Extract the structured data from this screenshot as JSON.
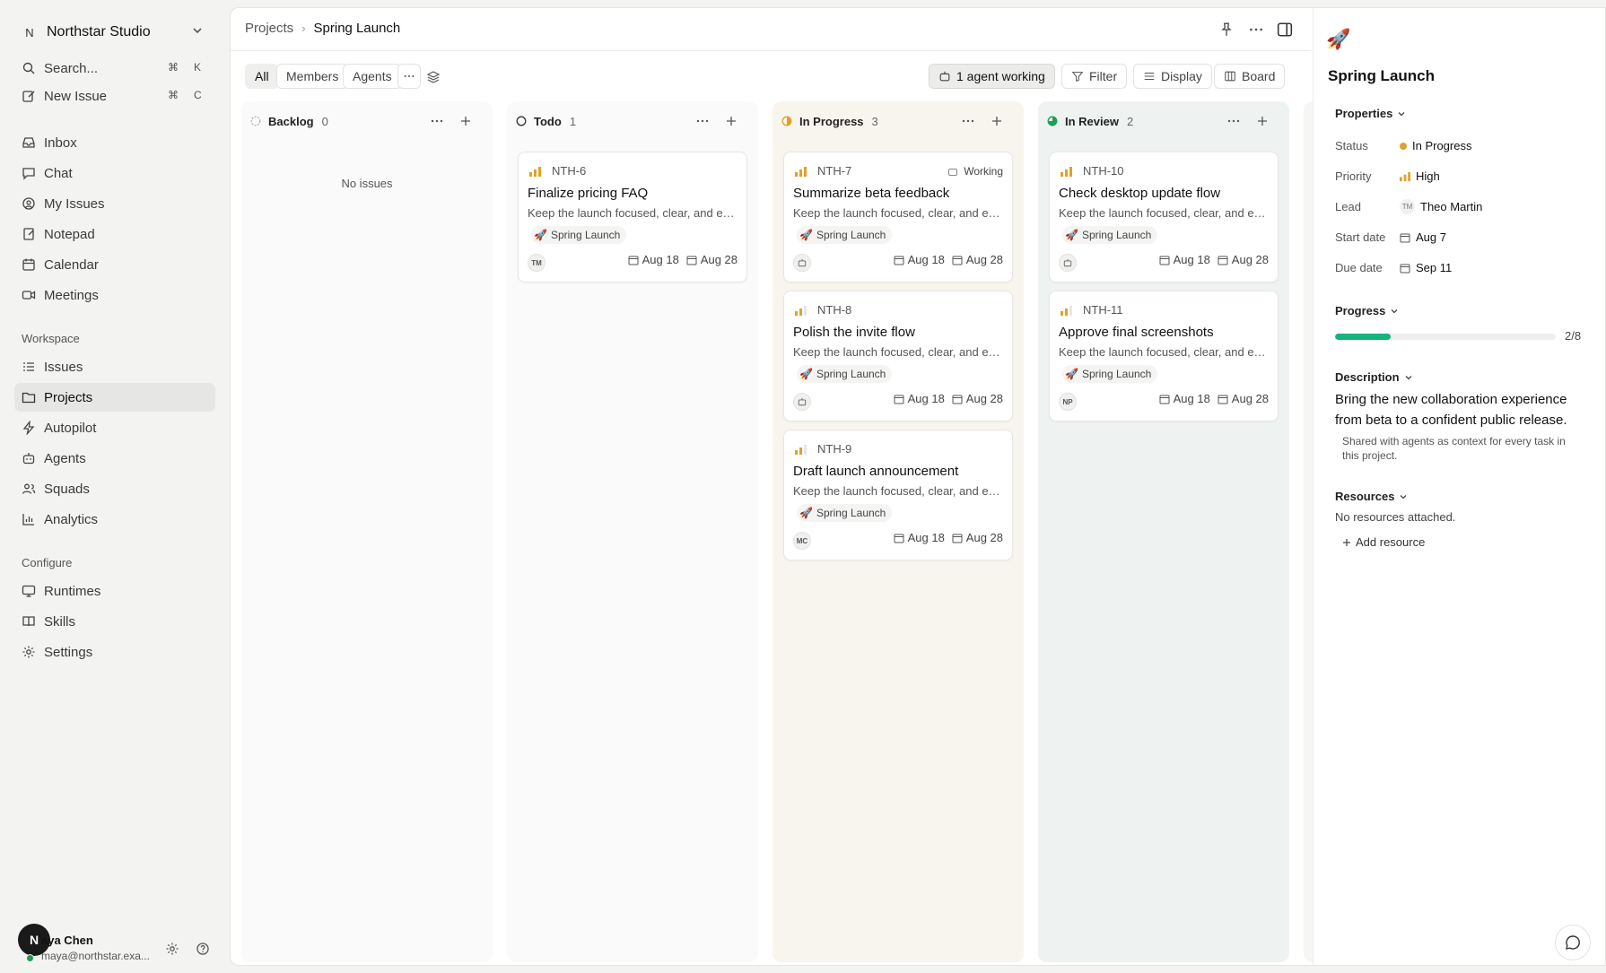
{
  "workspace": {
    "logo": "N",
    "name": "Northstar Studio"
  },
  "sidebar": {
    "search": {
      "label": "Search...",
      "kbd_mod": "⌘",
      "kbd_key": "K"
    },
    "new_issue": {
      "label": "New Issue",
      "kbd_mod": "⌘",
      "kbd_key": "C"
    },
    "primary": [
      {
        "label": "Inbox",
        "icon": "inbox-icon"
      },
      {
        "label": "Chat",
        "icon": "chat-icon"
      },
      {
        "label": "My Issues",
        "icon": "user-circle-icon"
      },
      {
        "label": "Notepad",
        "icon": "notepad-icon"
      },
      {
        "label": "Calendar",
        "icon": "calendar-icon"
      },
      {
        "label": "Meetings",
        "icon": "video-icon"
      }
    ],
    "workspace_heading": "Workspace",
    "workspace_items": [
      {
        "label": "Issues",
        "icon": "list-icon"
      },
      {
        "label": "Projects",
        "icon": "folder-icon"
      },
      {
        "label": "Autopilot",
        "icon": "bolt-icon"
      },
      {
        "label": "Agents",
        "icon": "bot-icon"
      },
      {
        "label": "Squads",
        "icon": "users-icon"
      },
      {
        "label": "Analytics",
        "icon": "chart-icon"
      }
    ],
    "configure_heading": "Configure",
    "configure_items": [
      {
        "label": "Runtimes",
        "icon": "monitor-icon"
      },
      {
        "label": "Skills",
        "icon": "book-icon"
      },
      {
        "label": "Settings",
        "icon": "gear-icon"
      }
    ],
    "active_item": "Projects"
  },
  "user": {
    "avatar": "N",
    "name": "aya Chen",
    "email": "maya@northstar.exa..."
  },
  "breadcrumb": {
    "parent": "Projects",
    "current": "Spring Launch"
  },
  "filters": {
    "tabs": [
      "All",
      "Members",
      "Agents"
    ],
    "selected_tab": "All",
    "agent_status": "1 agent working",
    "filter": "Filter",
    "display": "Display",
    "board": "Board"
  },
  "columns": [
    {
      "name": "Backlog",
      "count": "0",
      "empty_text": "No issues"
    },
    {
      "name": "Todo",
      "count": "1"
    },
    {
      "name": "In Progress",
      "count": "3"
    },
    {
      "name": "In Review",
      "count": "2"
    }
  ],
  "cards": {
    "todo": [
      {
        "id": "NTH-6",
        "title": "Finalize pricing FAQ",
        "desc": "Keep the launch focused, clear, and easy to follow.",
        "tag": "Spring Launch",
        "assignee": "TM",
        "start": "Aug 18",
        "due": "Aug 28"
      }
    ],
    "inprogress": [
      {
        "id": "NTH-7",
        "title": "Summarize beta feedback",
        "desc": "Keep the launch focused, clear, and easy to follow.",
        "tag": "Spring Launch",
        "assignee": "agent",
        "start": "Aug 18",
        "due": "Aug 28",
        "status": "Working"
      },
      {
        "id": "NTH-8",
        "title": "Polish the invite flow",
        "desc": "Keep the launch focused, clear, and easy to follow.",
        "tag": "Spring Launch",
        "assignee": "agent",
        "start": "Aug 18",
        "due": "Aug 28"
      },
      {
        "id": "NTH-9",
        "title": "Draft launch announcement",
        "desc": "Keep the launch focused, clear, and easy to follow.",
        "tag": "Spring Launch",
        "assignee": "MC",
        "start": "Aug 18",
        "due": "Aug 28"
      }
    ],
    "review": [
      {
        "id": "NTH-10",
        "title": "Check desktop update flow",
        "desc": "Keep the launch focused, clear, and easy to follow.",
        "tag": "Spring Launch",
        "assignee": "agent",
        "start": "Aug 18",
        "due": "Aug 28"
      },
      {
        "id": "NTH-11",
        "title": "Approve final screenshots",
        "desc": "Keep the launch focused, clear, and easy to follow.",
        "tag": "Spring Launch",
        "assignee": "NP",
        "start": "Aug 18",
        "due": "Aug 28"
      }
    ]
  },
  "project": {
    "emoji": "🚀",
    "title": "Spring Launch",
    "properties_heading": "Properties",
    "props": {
      "status_label": "Status",
      "status": "In Progress",
      "priority_label": "Priority",
      "priority": "High",
      "lead_label": "Lead",
      "lead_initials": "TM",
      "lead": "Theo Martin",
      "start_label": "Start date",
      "start": "Aug 7",
      "due_label": "Due date",
      "due": "Sep 11"
    },
    "progress_heading": "Progress",
    "progress_done": 2,
    "progress_total": 8,
    "progress_text": "2/8",
    "description_heading": "Description",
    "description": "Bring the new collaboration experience from beta to a confident public release.",
    "description_note": "Shared with agents as context for every task in this project.",
    "resources_heading": "Resources",
    "resources_empty": "No resources attached.",
    "add_resource": "Add resource"
  },
  "colors": {
    "accent_progress": "#16b47a",
    "priority": "#e0a12a",
    "in_review": "#1f9d55"
  }
}
